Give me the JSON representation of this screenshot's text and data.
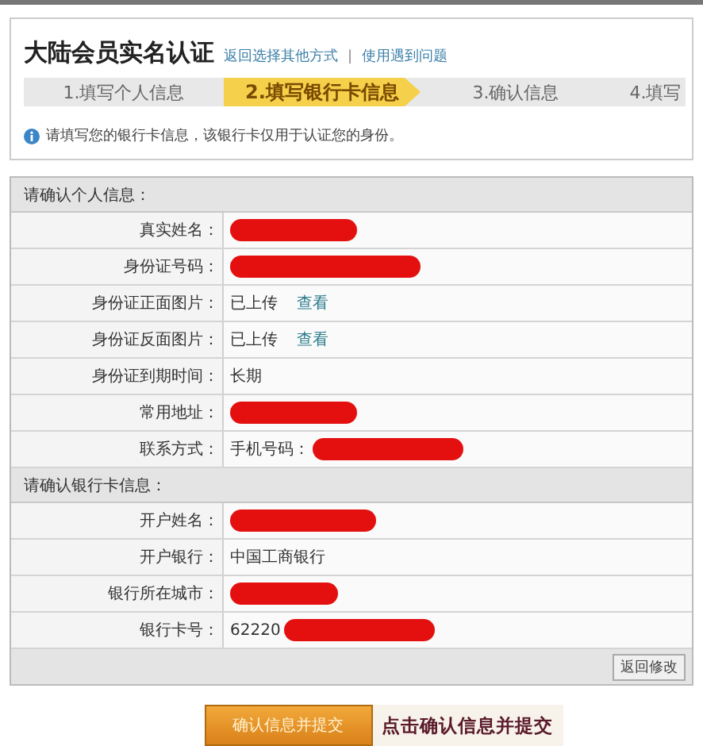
{
  "header": {
    "title": "大陆会员实名认证",
    "links": [
      "返回选择其他方式",
      "使用遇到问题"
    ],
    "separator": "|"
  },
  "steps": [
    {
      "label": "1.填写个人信息",
      "selected": false
    },
    {
      "label": "2.填写银行卡信息",
      "selected": true
    },
    {
      "label": "3.确认信息",
      "selected": false
    },
    {
      "label": "4.填写",
      "selected": false
    }
  ],
  "notice": "请填写您的银行卡信息，该银行卡仅用于认证您的身份。",
  "sections": [
    {
      "heading": "请确认个人信息：",
      "rows": [
        {
          "label": "真实姓名：",
          "kind": "redacted"
        },
        {
          "label": "身份证号码：",
          "kind": "redacted"
        },
        {
          "label": "身份证正面图片：",
          "kind": "uploaded",
          "value": "已上传",
          "link": "查看"
        },
        {
          "label": "身份证反面图片：",
          "kind": "uploaded",
          "value": "已上传",
          "link": "查看"
        },
        {
          "label": "身份证到期时间：",
          "kind": "text",
          "value": "长期"
        },
        {
          "label": "常用地址：",
          "kind": "redacted"
        },
        {
          "label": "联系方式：",
          "kind": "prefixed",
          "value": "手机号码："
        }
      ]
    },
    {
      "heading": "请确认银行卡信息：",
      "rows": [
        {
          "label": "开户姓名：",
          "kind": "redacted"
        },
        {
          "label": "开户银行：",
          "kind": "text",
          "value": "中国工商银行"
        },
        {
          "label": "银行所在城市：",
          "kind": "redacted"
        },
        {
          "label": "银行卡号：",
          "kind": "prefixed",
          "value": "62220"
        }
      ]
    }
  ],
  "back_button": "返回修改",
  "submit_button": "确认信息并提交",
  "annotation": "点击确认信息并提交"
}
